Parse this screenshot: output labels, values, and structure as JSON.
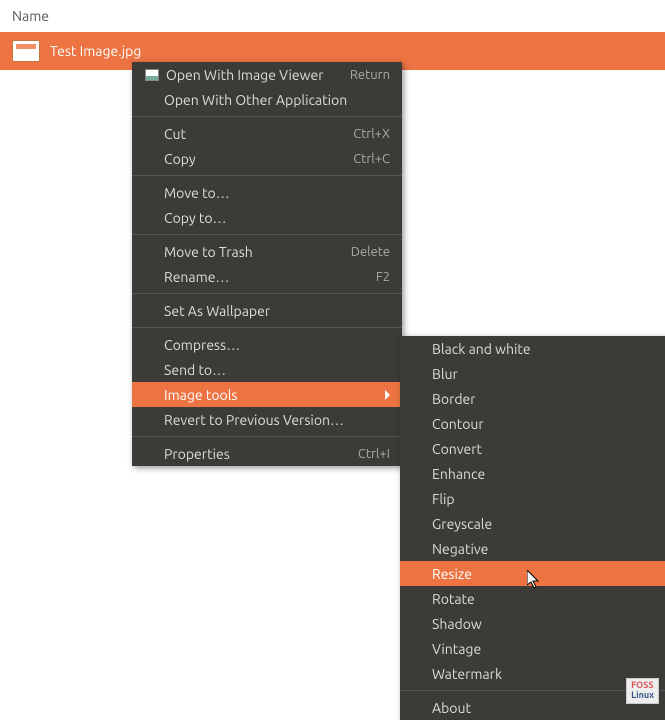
{
  "header": {
    "column_label": "Name"
  },
  "file": {
    "name": "Test Image.jpg"
  },
  "context_menu": {
    "open_with_viewer": {
      "label": "Open With Image Viewer",
      "shortcut": "Return"
    },
    "open_with_other": {
      "label": "Open With Other Application"
    },
    "cut": {
      "label": "Cut",
      "shortcut": "Ctrl+X"
    },
    "copy": {
      "label": "Copy",
      "shortcut": "Ctrl+C"
    },
    "move_to": {
      "label": "Move to…"
    },
    "copy_to": {
      "label": "Copy to…"
    },
    "move_to_trash": {
      "label": "Move to Trash",
      "shortcut": "Delete"
    },
    "rename": {
      "label": "Rename…",
      "shortcut": "F2"
    },
    "set_wallpaper": {
      "label": "Set As Wallpaper"
    },
    "compress": {
      "label": "Compress…"
    },
    "send_to": {
      "label": "Send to…"
    },
    "image_tools": {
      "label": "Image tools"
    },
    "revert": {
      "label": "Revert to Previous Version…"
    },
    "properties": {
      "label": "Properties",
      "shortcut": "Ctrl+I"
    }
  },
  "submenu": {
    "bw": "Black and white",
    "blur": "Blur",
    "border": "Border",
    "contour": "Contour",
    "convert": "Convert",
    "enhance": "Enhance",
    "flip": "Flip",
    "greyscale": "Greyscale",
    "negative": "Negative",
    "resize": "Resize",
    "rotate": "Rotate",
    "shadow": "Shadow",
    "vintage": "Vintage",
    "watermark": "Watermark",
    "about": "About"
  },
  "watermark": {
    "line1": "FOSS",
    "line2": "Linux"
  }
}
